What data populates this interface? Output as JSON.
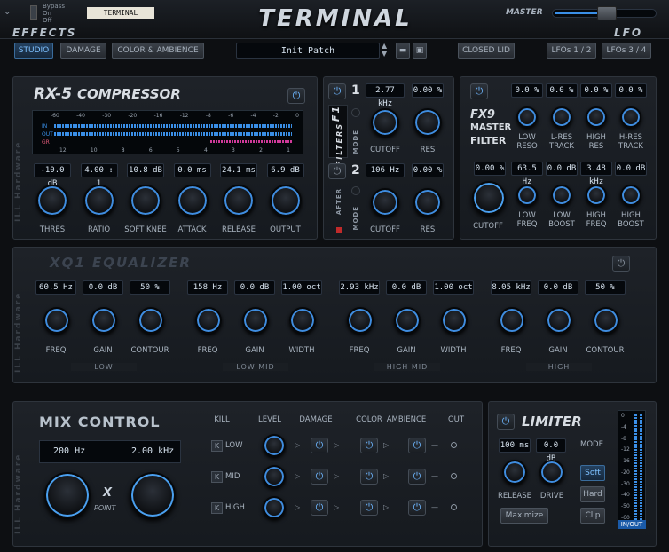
{
  "header": {
    "bypass_label": "Bypass",
    "on_label": "On",
    "off_label": "Off",
    "preset_tag": "TERMINAL",
    "logo": "TERMINAL",
    "master_label": "MASTER"
  },
  "tabs": {
    "effects_label": "EFFECTS",
    "lfo_label": "LFO",
    "studio": "STUDIO",
    "damage": "DAMAGE",
    "color": "COLOR & AMBIENCE",
    "patch": "Init Patch",
    "closed_lid": "CLOSED LID",
    "lfo12": "LFOs 1 / 2",
    "lfo34": "LFOs 3 / 4"
  },
  "side_brand": "ILL Hardware",
  "compressor": {
    "title": "RX-5",
    "subtitle": "COMPRESSOR",
    "scale_top": [
      "-60",
      "-40",
      "-30",
      "-20",
      "-16",
      "-12",
      "-8",
      "-6",
      "-4",
      "-2",
      "0"
    ],
    "scale_bottom": [
      "12",
      "10",
      "8",
      "6",
      "5",
      "4",
      "3",
      "2",
      "1"
    ],
    "rows": [
      "IN",
      "OUT",
      "GR"
    ],
    "values": {
      "thres": "-10.0 dB",
      "ratio": "4.00 : 1",
      "soft_knee": "10.8 dB",
      "attack": "0.0 ms",
      "release": "24.1 ms",
      "output": "6.9 dB"
    },
    "labels": {
      "thres": "THRES",
      "ratio": "RATIO",
      "soft_knee": "SOFT KNEE",
      "attack": "ATTACK",
      "release": "RELEASE",
      "output": "OUTPUT"
    }
  },
  "filters": {
    "tag": "FILTERS",
    "f1": "F1",
    "after": "AFTER",
    "mode": "MODE",
    "num1": "1",
    "num2": "2",
    "f1_cutoff": "2.77 kHz",
    "f1_res": "0.00 %",
    "f2_cutoff": "106 Hz",
    "f2_res": "0.00 %",
    "cutoff": "CUTOFF",
    "res": "RES"
  },
  "fx9": {
    "title": "FX9",
    "sub1": "MASTER",
    "sub2": "FILTER",
    "top_values": [
      "0.0 %",
      "0.0 %",
      "0.0 %",
      "0.0 %"
    ],
    "top_labels": [
      "LOW RESO",
      "L-RES TRACK",
      "HIGH RES",
      "H-RES TRACK"
    ],
    "cutoff_value": "0.00 %",
    "cutoff_label": "CUTOFF",
    "bottom_values": [
      "63.5 Hz",
      "0.0 dB",
      "3.48 kHz",
      "0.0 dB"
    ],
    "bottom_labels": [
      "LOW FREQ",
      "LOW BOOST",
      "HIGH FREQ",
      "HIGH BOOST"
    ]
  },
  "eq": {
    "title": "XQ1",
    "subtitle": "EQUALIZER",
    "bands": [
      {
        "name": "LOW",
        "v": [
          "60.5 Hz",
          "0.0 dB",
          "50 %"
        ],
        "l": [
          "FREQ",
          "GAIN",
          "CONTOUR"
        ]
      },
      {
        "name": "LOW MID",
        "v": [
          "158 Hz",
          "0.0 dB",
          "1.00 oct"
        ],
        "l": [
          "FREQ",
          "GAIN",
          "WIDTH"
        ]
      },
      {
        "name": "HIGH MID",
        "v": [
          "2.93 kHz",
          "0.0 dB",
          "1.00 oct"
        ],
        "l": [
          "FREQ",
          "GAIN",
          "WIDTH"
        ]
      },
      {
        "name": "HIGH",
        "v": [
          "8.05 kHz",
          "0.0 dB",
          "50 %"
        ],
        "l": [
          "FREQ",
          "GAIN",
          "CONTOUR"
        ]
      }
    ]
  },
  "mix": {
    "title": "MIX CONTROL",
    "low_freq": "200 Hz",
    "high_freq": "2.00 kHz",
    "xpoint_x": "X",
    "xpoint_label": "POINT",
    "headers": [
      "KILL",
      "LEVEL",
      "DAMAGE",
      "COLOR",
      "AMBIENCE",
      "OUT"
    ],
    "rows": [
      "LOW",
      "MID",
      "HIGH"
    ],
    "kill_key": "K"
  },
  "limiter": {
    "title": "LIMITER",
    "release_value": "100 ms",
    "drive_value": "0.0 dB",
    "release": "RELEASE",
    "drive": "DRIVE",
    "mode": "MODE",
    "soft": "Soft",
    "hard": "Hard",
    "clip": "Clip",
    "maximize": "Maximize",
    "scale": [
      "0",
      "-4",
      "-8",
      "-12",
      "-16",
      "-20",
      "-30",
      "-40",
      "-50",
      "-60"
    ],
    "inout": "IN/OUT"
  }
}
